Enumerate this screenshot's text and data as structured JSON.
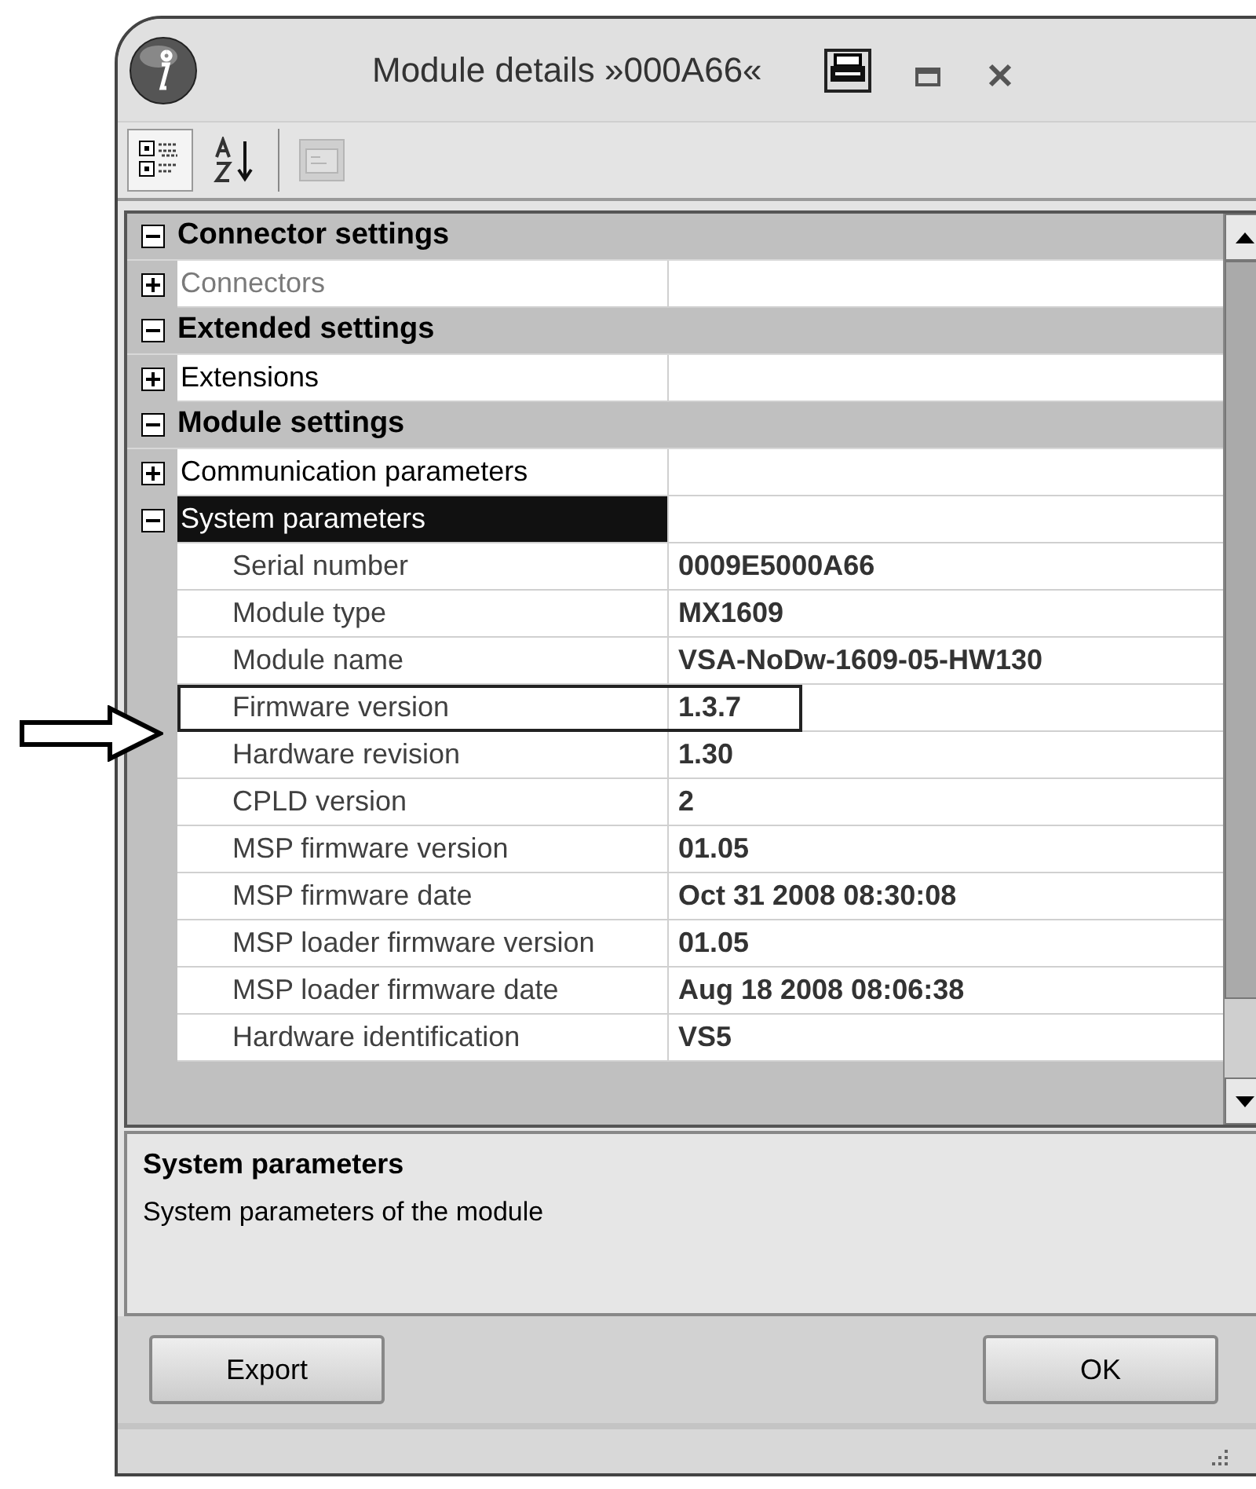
{
  "window": {
    "title": "Module details »000A66«"
  },
  "toolbar": [
    {
      "kind": "categorized",
      "selected": true
    },
    {
      "kind": "alphabetical",
      "selected": false
    },
    {
      "kind": "pages",
      "disabled": true
    }
  ],
  "grid": {
    "categories": [
      {
        "label": "Connector settings",
        "expanded": true,
        "children": [
          {
            "label": "Connectors",
            "expanded": false,
            "disabled": true,
            "selected": false
          }
        ]
      },
      {
        "label": "Extended settings",
        "expanded": true,
        "children": [
          {
            "label": "Extensions",
            "expanded": false,
            "disabled": false,
            "selected": false
          }
        ]
      },
      {
        "label": "Module settings",
        "expanded": true,
        "children": [
          {
            "label": "Communication parameters",
            "expanded": false,
            "disabled": false,
            "selected": false
          },
          {
            "label": "System parameters",
            "expanded": true,
            "disabled": false,
            "selected": true,
            "children": [
              {
                "label": "Serial number",
                "value": "0009E5000A66",
                "highlighted": false
              },
              {
                "label": "Module type",
                "value": "MX1609",
                "highlighted": false
              },
              {
                "label": "Module name",
                "value": "VSA-NoDw-1609-05-HW130",
                "highlighted": false
              },
              {
                "label": "Firmware version",
                "value": "1.3.7",
                "highlighted": true
              },
              {
                "label": "Hardware revision",
                "value": "1.30",
                "highlighted": false
              },
              {
                "label": "CPLD version",
                "value": "2",
                "highlighted": false
              },
              {
                "label": "MSP firmware version",
                "value": "01.05",
                "highlighted": false
              },
              {
                "label": "MSP firmware date",
                "value": "Oct 31 2008 08:30:08",
                "highlighted": false
              },
              {
                "label": "MSP loader firmware version",
                "value": "01.05",
                "highlighted": false
              },
              {
                "label": "MSP loader firmware date",
                "value": "Aug 18 2008 08:06:38",
                "highlighted": false
              },
              {
                "label": "Hardware identification",
                "value": "VS5",
                "highlighted": false
              }
            ]
          }
        ]
      }
    ]
  },
  "description": {
    "title": "System parameters",
    "text": "System parameters of the module"
  },
  "buttons": [
    {
      "label": "Export"
    },
    {
      "label": "OK"
    }
  ]
}
